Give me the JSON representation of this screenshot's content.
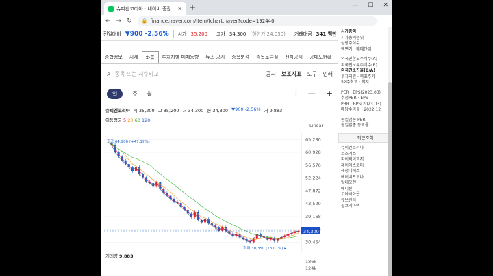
{
  "browser": {
    "tab_title": "슈피겐코리아 : 네이버 증권",
    "url": "finance.naver.com/item/fchart.naver?code=192440"
  },
  "ticker": {
    "label": "전일대비",
    "arrow": "▼",
    "change": "900",
    "pct": "-2.56%",
    "open_label": "시가",
    "open": "35,200",
    "high_label": "고가",
    "high": "34,300",
    "extra": "(하한가 24,050)",
    "vol_label": "거래대금",
    "vol": "341 백만"
  },
  "nav": [
    "종합정보",
    "시세",
    "차트",
    "투자자별 매매동향",
    "뉴스 공시",
    "종목분석",
    "종목토론실",
    "전자공시",
    "공매도현황"
  ],
  "search": {
    "placeholder": "종목 또는 지수비교",
    "tools": [
      "공시",
      "보조지표",
      "도구",
      "인쇄"
    ]
  },
  "period": [
    "일",
    "주",
    "월"
  ],
  "info": {
    "name": "슈피겐코리아",
    "o": "시 35,200",
    "h": "고 35,200",
    "l": "저 34,300",
    "c": "종 34,300",
    "chg": "▼900 -2.56%",
    "v": "거 9,883"
  },
  "ma": {
    "label": "이동평균",
    "v5": "5",
    "v20": "20",
    "v60": "60",
    "v120": "120"
  },
  "scale": "Linear",
  "chart_data": {
    "type": "line",
    "y_ticks": [
      "65,280",
      "60,928",
      "56,576",
      "52,224",
      "47,872",
      "43,520",
      "39,168",
      "34,816",
      "30,464"
    ],
    "current": "34,300",
    "max_label": "최고 64,900 (+47.19%)",
    "min_label": "최저 30,350 (13.01%) ▸",
    "ylim": [
      28500,
      66500
    ],
    "close": [
      64200,
      63500,
      61000,
      59500,
      58200,
      57000,
      55800,
      54500,
      56000,
      53500,
      52500,
      51000,
      50500,
      49500,
      50800,
      48500,
      47200,
      46200,
      45100,
      44200,
      43800,
      42400,
      41500,
      40200,
      39000,
      40800,
      38000,
      37200,
      38400,
      36800,
      36100,
      35400,
      34300,
      35600,
      34200,
      33400,
      32600,
      33200,
      32100,
      31500,
      30900,
      30500,
      31600,
      33200,
      32400,
      32100,
      31400,
      31800,
      30900,
      31500,
      32200,
      32700,
      33200,
      33600,
      34100,
      34300
    ]
  },
  "volume": {
    "label": "거래량",
    "value": "9,883",
    "ticks": [
      "186k",
      "124k"
    ]
  },
  "sidebar": {
    "lines": [
      "시가총액",
      "시가총액순위",
      "상장주식수",
      "액면가 · 매매단위",
      "외국인한도주식수(A)",
      "외국인보유주식수(B)",
      "외국인소진율(B/A)",
      "투자의견 · 목표주가",
      "52주최고 · 최저",
      "PER · EPS(2023.03)",
      "추정PER · EPS",
      "PBR · BPS(2023.03)",
      "배당수익률 · 2022.12",
      "동일업종 PER",
      "동일업종 등락률"
    ],
    "recent_title": "최근조회",
    "recent": [
      "슈피겐코리아",
      "코스맥스",
      "파이써이엠지",
      "제이에스코퍼",
      "해성디에스",
      "에이비프로바",
      "알테오젠",
      "애니젠",
      "코아시아옵",
      "큐브엔터",
      "필코리아텍"
    ]
  }
}
